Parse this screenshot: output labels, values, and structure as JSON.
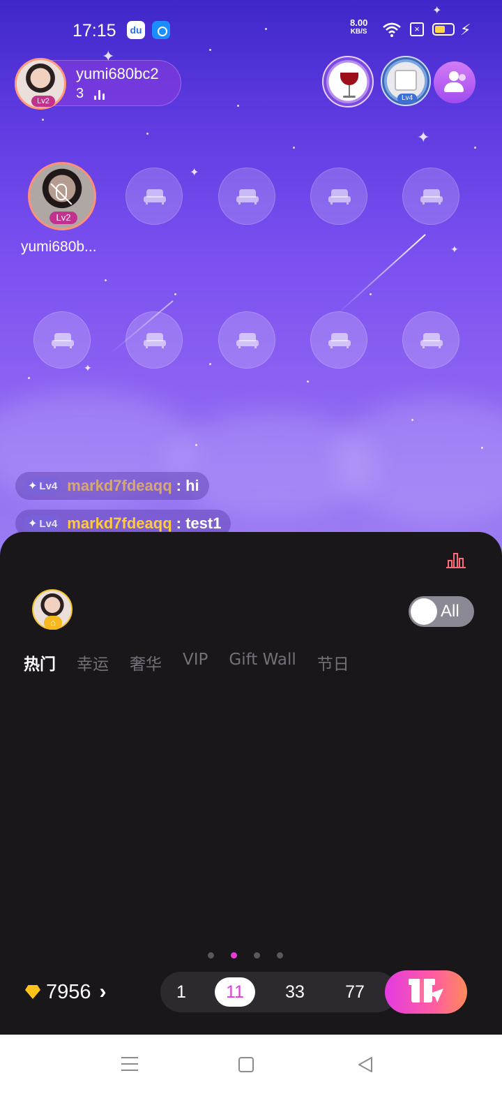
{
  "status_bar": {
    "time": "17:15",
    "net_speed": "8.00",
    "net_unit": "KB/S",
    "battery_percent": 60,
    "icons": [
      "baidu-app-icon",
      "app-icon",
      "wifi-icon",
      "sim-disabled-icon",
      "battery-icon",
      "charging-icon"
    ]
  },
  "room": {
    "host": {
      "name": "yumi680bc2",
      "level": "Lv2",
      "online_count": "3"
    },
    "badges": [
      {
        "name": "wine-glass-badge"
      },
      {
        "name": "mug-badge",
        "level": "Lv4"
      }
    ],
    "seats": {
      "host_seat": {
        "name": "yumi680b...",
        "level": "Lv2"
      }
    },
    "chat": [
      {
        "level": "Lv4",
        "user": "markd7fdeaqq",
        "message": ": hi",
        "user_color": "#d6a875"
      },
      {
        "level": "Lv4",
        "user": "markd7fdeaqq",
        "message": ": test1",
        "user_color": "#ffcb3a"
      }
    ]
  },
  "gift_panel": {
    "toggle_label": "All",
    "tabs": [
      {
        "label": "热门",
        "active": true
      },
      {
        "label": "幸运",
        "active": false
      },
      {
        "label": "奢华",
        "active": false
      },
      {
        "label": "VIP",
        "active": false
      },
      {
        "label": "Gift Wall",
        "active": false
      },
      {
        "label": "节日",
        "active": false
      }
    ],
    "page_dots": 4,
    "active_page": 2,
    "balance": "7956",
    "quantities": [
      "1",
      "11",
      "33",
      "77"
    ],
    "selected_quantity": "11",
    "accent_color": "#e23bdc"
  }
}
